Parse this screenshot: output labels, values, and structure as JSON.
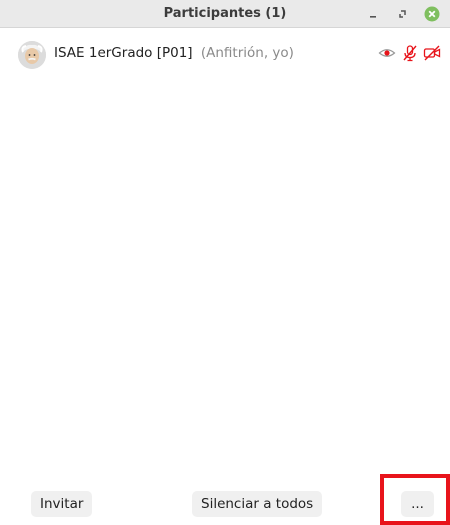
{
  "window": {
    "title": "Participantes (1)"
  },
  "participants": [
    {
      "name": "ISAE 1erGrado [P01]",
      "role": "(Anfitrión, yo)",
      "icons": [
        "avatar-einstein",
        "recording-icon",
        "mic-muted-icon",
        "video-off-icon"
      ]
    }
  ],
  "footer": {
    "invite_label": "Invitar",
    "mute_all_label": "Silenciar a todos",
    "more_label": "..."
  },
  "colors": {
    "titlebar_bg": "#eaeaea",
    "close_button": "#7fbf5f",
    "status_red": "#e8141b",
    "button_bg": "#f0f0f0",
    "highlight_box": "#e8141b"
  }
}
